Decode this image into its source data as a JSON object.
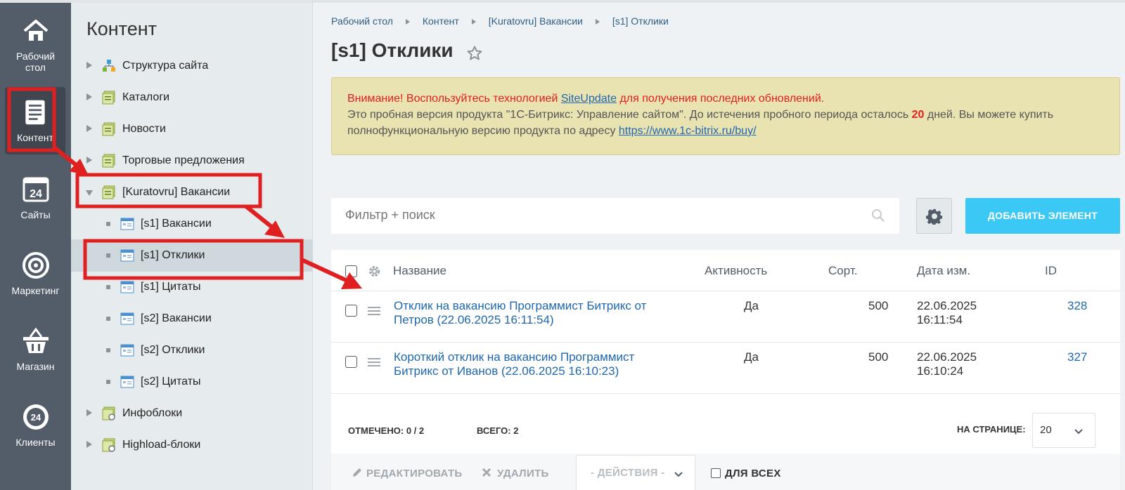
{
  "leftbar": {
    "items": [
      {
        "label": "Рабочий стол",
        "icon": "home-icon"
      },
      {
        "label": "Контент",
        "icon": "document-icon"
      },
      {
        "label": "Сайты",
        "icon": "calendar-24-icon"
      },
      {
        "label": "Маркетинг",
        "icon": "target-icon"
      },
      {
        "label": "Магазин",
        "icon": "basket-icon"
      },
      {
        "label": "Клиенты",
        "icon": "crm-24-icon"
      }
    ]
  },
  "tree": {
    "title": "Контент",
    "items": [
      {
        "label": "Структура сайта"
      },
      {
        "label": "Каталоги"
      },
      {
        "label": "Новости"
      },
      {
        "label": "Торговые предложения"
      },
      {
        "label": "[Kuratovru] Вакансии"
      },
      {
        "label": "[s1] Вакансии"
      },
      {
        "label": "[s1] Отклики"
      },
      {
        "label": "[s1] Цитаты"
      },
      {
        "label": "[s2] Вакансии"
      },
      {
        "label": "[s2] Отклики"
      },
      {
        "label": "[s2] Цитаты"
      },
      {
        "label": "Инфоблоки"
      },
      {
        "label": "Highload-блоки"
      }
    ]
  },
  "breadcrumb": [
    "Рабочий стол",
    "Контент",
    "[Kuratovru] Вакансии",
    "[s1] Отклики"
  ],
  "page_title": "[s1] Отклики",
  "notice": {
    "warn_before": "Внимание! Воспользуйтесь технологией ",
    "warn_link": "SiteUpdate",
    "warn_after": " для получения последних обновлений.",
    "line2_before": "Это пробная версия продукта \"1С-Битрикс: Управление сайтом\". До истечения пробного периода осталось ",
    "days": "20",
    "line2_after": " дней. Вы можете купить полнофункциональную версию продукта по адресу ",
    "buy_link": "https://www.1c-bitrix.ru/buy/"
  },
  "filter": {
    "placeholder": "Фильтр + поиск"
  },
  "add_button": "ДОБАВИТЬ ЭЛЕМЕНТ",
  "grid": {
    "columns": {
      "name": "Название",
      "active": "Активность",
      "sort": "Сорт.",
      "date": "Дата изм.",
      "id": "ID"
    },
    "rows": [
      {
        "name_line1": "Отклик на вакансию Программист Битрикс от",
        "name_line2": "Петров (22.06.2025 16:11:54)",
        "active": "Да",
        "sort": "500",
        "date_line1": "22.06.2025",
        "date_line2": "16:11:54",
        "id": "328"
      },
      {
        "name_line1": "Короткий отклик на вакансию Программист",
        "name_line2": "Битрикс от Иванов (22.06.2025 16:10:23)",
        "active": "Да",
        "sort": "500",
        "date_line1": "22.06.2025",
        "date_line2": "16:10:24",
        "id": "327"
      }
    ],
    "footer": {
      "marked_label": "ОТМЕЧЕНО:",
      "marked_value": "0 / 2",
      "total_label": "ВСЕГО:",
      "total_value": "2",
      "per_page_label": "НА СТРАНИЦЕ:",
      "per_page_value": "20"
    },
    "panel": {
      "edit": "РЕДАКТИРОВАТЬ",
      "delete": "УДАЛИТЬ",
      "actions": "- ДЕЙСТВИЯ -",
      "for_all": "ДЛЯ ВСЕХ"
    }
  },
  "colors": {
    "annotation": "#e02020",
    "accent": "#3bc8f5",
    "link": "#2067b0",
    "sidebar": "#535c69"
  }
}
